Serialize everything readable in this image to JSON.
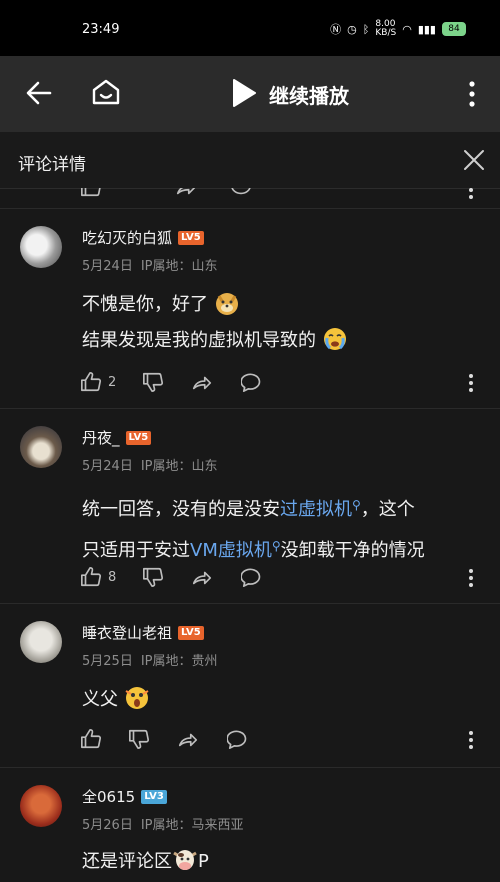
{
  "status": {
    "time": "23:49",
    "net_speed_top": "8.00",
    "net_speed_bottom": "KB/S",
    "battery": "84"
  },
  "topbar": {
    "continue_play_label": "继续播放"
  },
  "panel": {
    "title": "评论详情"
  },
  "comments": [
    {
      "username": "吃幻灭的白狐",
      "level": "LV5",
      "level_color": "#e8642c",
      "date": "5月24日",
      "ip": "IP属地：山东",
      "lines": [
        {
          "text": "不愧是你，好了"
        },
        {
          "text": "结果发现是我的虚拟机导致的"
        }
      ],
      "likes": "2"
    },
    {
      "username": "丹夜_",
      "level": "LV5",
      "level_color": "#e8642c",
      "date": "5月24日",
      "ip": "IP属地：山东",
      "line1": {
        "pre": "统一回答，没有的是没安",
        "link": "过虚拟机",
        "post": "，这个"
      },
      "line2": {
        "pre": "只适用于安过",
        "link": "VM虚拟机",
        "post": "没卸载干净的情况"
      },
      "likes": "8"
    },
    {
      "username": "睡衣登山老祖",
      "level": "LV5",
      "level_color": "#e8642c",
      "date": "5月25日",
      "ip": "IP属地：贵州",
      "lines": [
        {
          "text": "义父"
        }
      ],
      "likes": ""
    },
    {
      "username": "全0615",
      "level": "LV3",
      "level_color": "#4aa6d8",
      "date": "5月26日",
      "ip": "IP属地：马来西亚",
      "text_pre": "还是评论区",
      "text_post": "P"
    }
  ]
}
